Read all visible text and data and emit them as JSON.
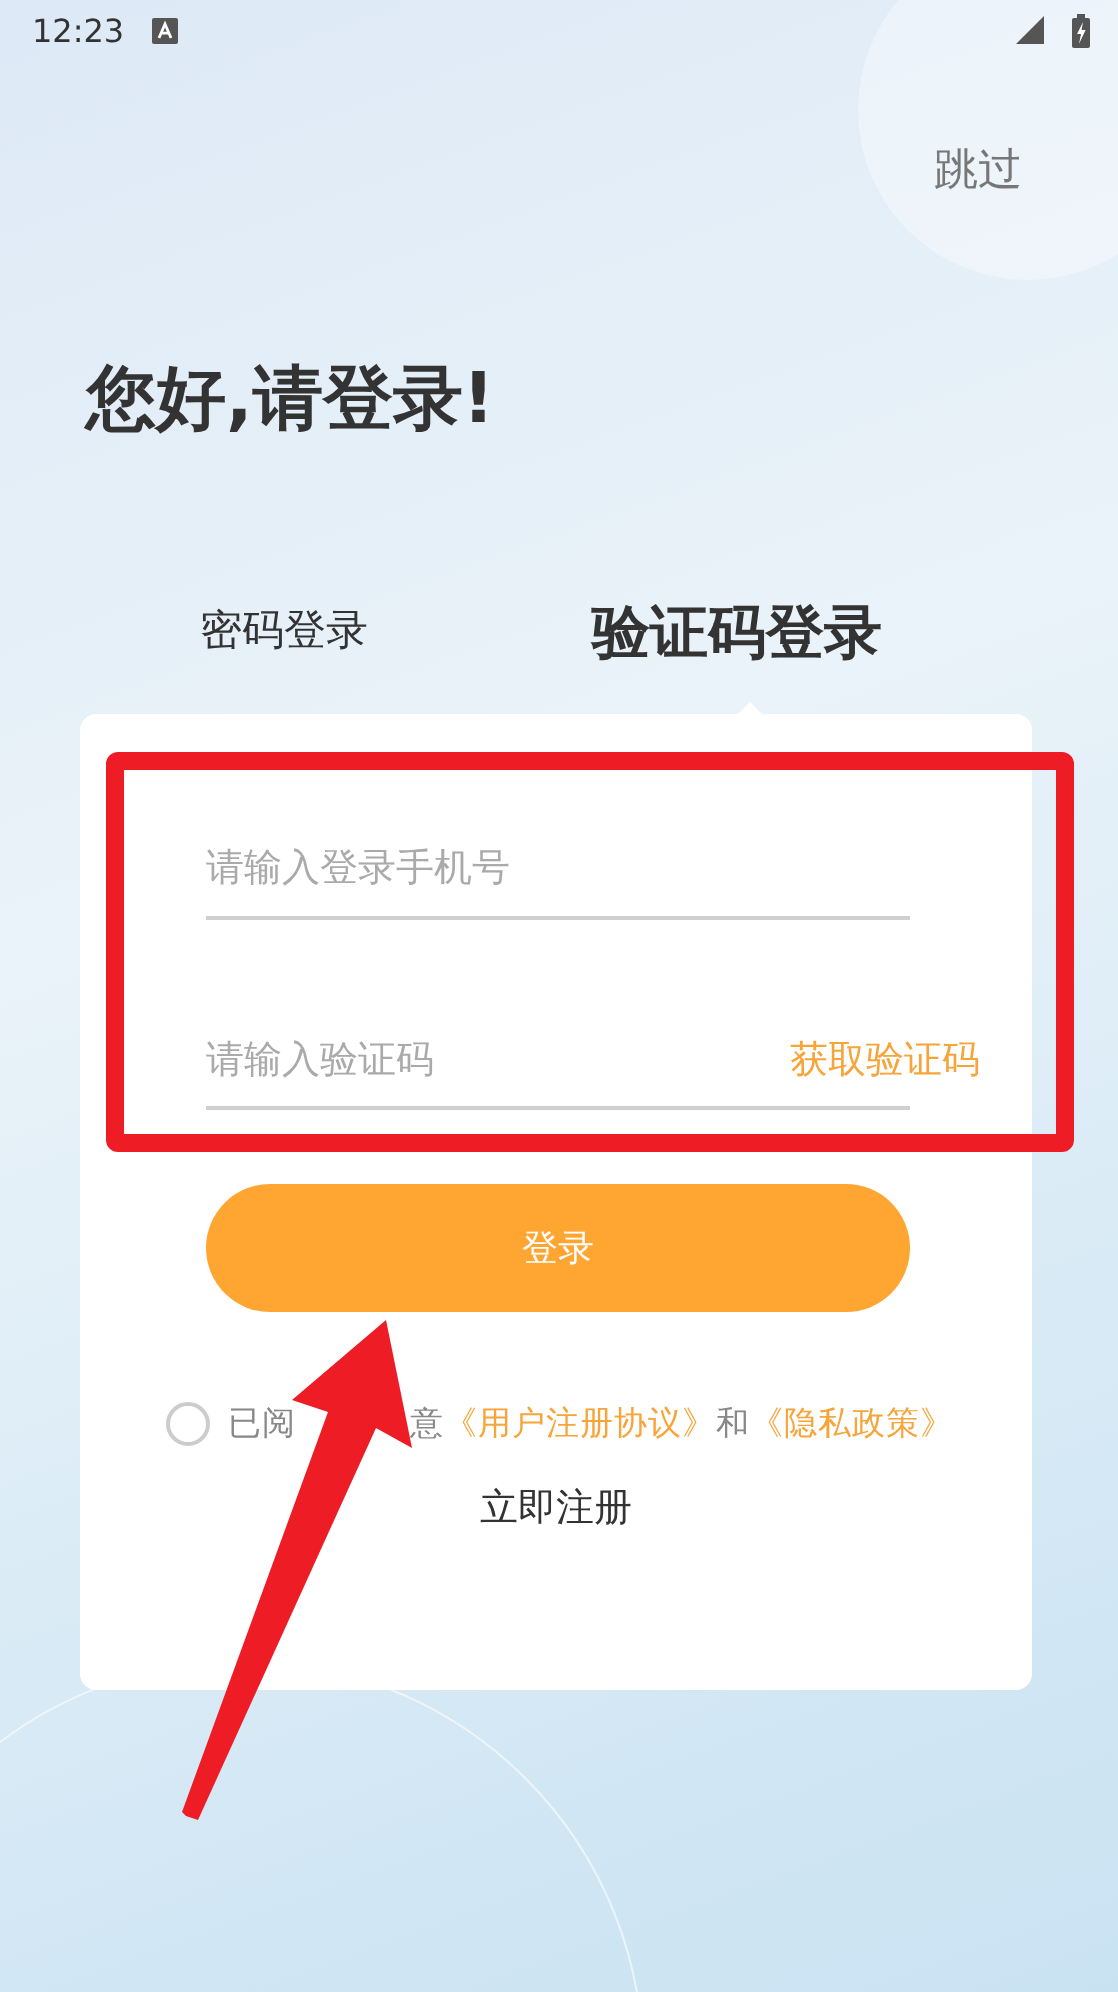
{
  "status_bar": {
    "time": "12:23"
  },
  "skip": "跳过",
  "title": "您好,请登录!",
  "tabs": [
    {
      "label": "密码登录",
      "selected": false
    },
    {
      "label": "验证码登录",
      "selected": true
    }
  ],
  "form": {
    "phone": {
      "placeholder": "请输入登录手机号"
    },
    "code": {
      "placeholder": "请输入验证码"
    },
    "get_code": "获取验证码",
    "submit": "登录"
  },
  "agreement": {
    "checked": false,
    "parts": [
      {
        "kind": "text",
        "text": "已阅"
      },
      {
        "kind": "hidden"
      },
      {
        "kind": "text",
        "text": "意"
      },
      {
        "kind": "link",
        "text": "《用户注册协议》"
      },
      {
        "kind": "text",
        "text": "和"
      },
      {
        "kind": "link",
        "text": "《隐私政策》"
      }
    ]
  },
  "register": "立即注册"
}
